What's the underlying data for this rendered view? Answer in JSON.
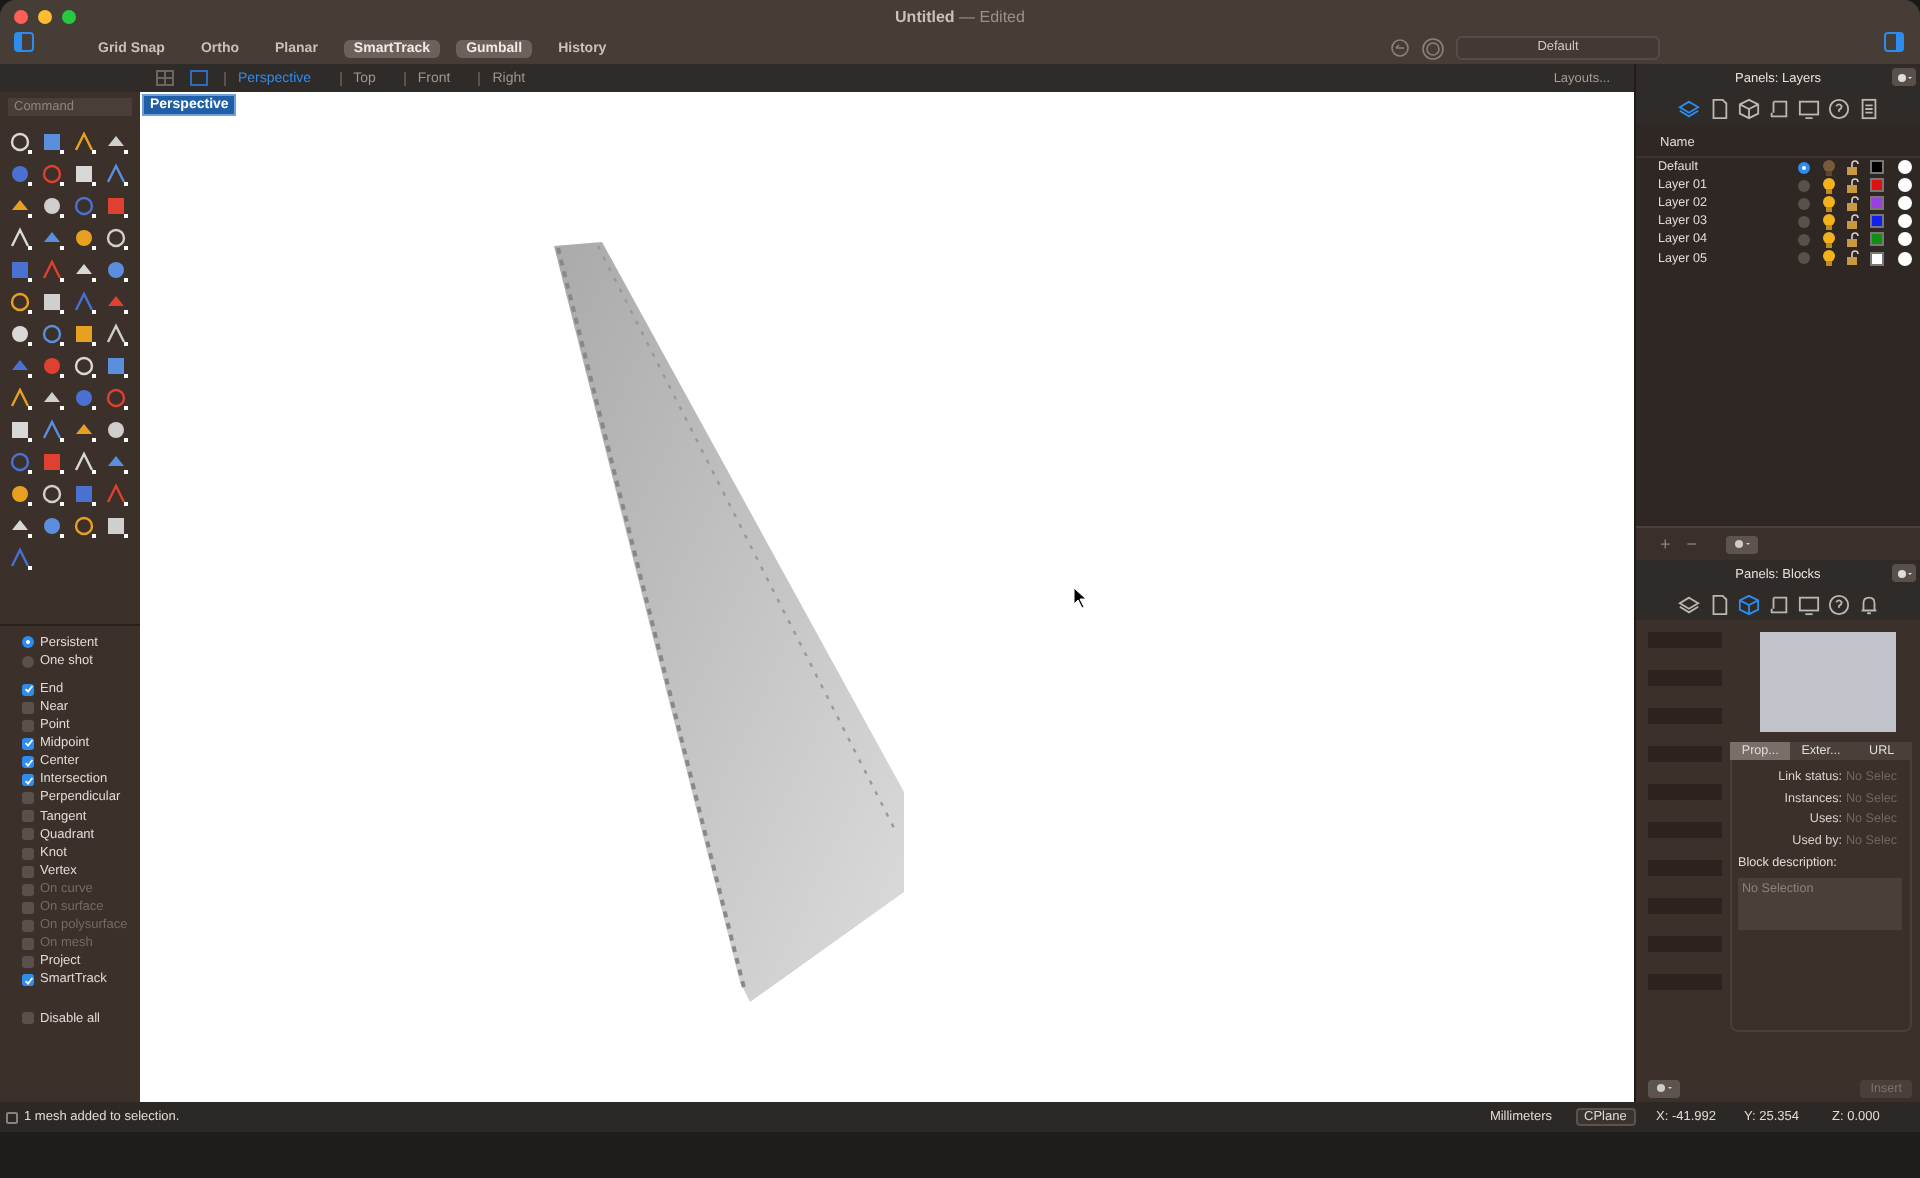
{
  "window": {
    "title": "Untitled",
    "subtitle": "— Edited"
  },
  "toolbar": {
    "toggles": [
      {
        "label": "Grid Snap",
        "on": false
      },
      {
        "label": "Ortho",
        "on": false
      },
      {
        "label": "Planar",
        "on": false
      },
      {
        "label": "SmartTrack",
        "on": true
      },
      {
        "label": "Gumball",
        "on": true
      },
      {
        "label": "History",
        "on": false
      }
    ],
    "layer_field": "Default"
  },
  "command": {
    "placeholder": "Command"
  },
  "viewport_tabs": [
    {
      "label": "Perspective",
      "selected": true
    },
    {
      "label": "Top",
      "selected": false
    },
    {
      "label": "Front",
      "selected": false
    },
    {
      "label": "Right",
      "selected": false
    }
  ],
  "layouts_button": "Layouts...",
  "viewport": {
    "label": "Perspective"
  },
  "osnap": [
    {
      "kind": "radio",
      "label": "Persistent",
      "checked": true,
      "disabled": false
    },
    {
      "kind": "radio",
      "label": "One shot",
      "checked": false,
      "disabled": false
    },
    {
      "kind": "check",
      "label": "End",
      "checked": true,
      "disabled": false
    },
    {
      "kind": "check",
      "label": "Near",
      "checked": false,
      "disabled": false
    },
    {
      "kind": "check",
      "label": "Point",
      "checked": false,
      "disabled": false
    },
    {
      "kind": "check",
      "label": "Midpoint",
      "checked": true,
      "disabled": false
    },
    {
      "kind": "check",
      "label": "Center",
      "checked": true,
      "disabled": false
    },
    {
      "kind": "check",
      "label": "Intersection",
      "checked": true,
      "disabled": false
    },
    {
      "kind": "check",
      "label": "Perpendicular",
      "checked": false,
      "disabled": false
    },
    {
      "kind": "check",
      "label": "Tangent",
      "checked": false,
      "disabled": false
    },
    {
      "kind": "check",
      "label": "Quadrant",
      "checked": false,
      "disabled": false
    },
    {
      "kind": "check",
      "label": "Knot",
      "checked": false,
      "disabled": false
    },
    {
      "kind": "check",
      "label": "Vertex",
      "checked": false,
      "disabled": false
    },
    {
      "kind": "check",
      "label": "On curve",
      "checked": false,
      "disabled": true
    },
    {
      "kind": "check",
      "label": "On surface",
      "checked": false,
      "disabled": true
    },
    {
      "kind": "check",
      "label": "On polysurface",
      "checked": false,
      "disabled": true
    },
    {
      "kind": "check",
      "label": "On mesh",
      "checked": false,
      "disabled": true
    },
    {
      "kind": "check",
      "label": "Project",
      "checked": false,
      "disabled": false
    },
    {
      "kind": "check",
      "label": "SmartTrack",
      "checked": true,
      "disabled": false
    },
    {
      "kind": "check",
      "label": "Disable all",
      "checked": false,
      "disabled": false
    }
  ],
  "layers_panel": {
    "title": "Panels: Layers",
    "column": "Name",
    "layers": [
      {
        "name": "Default",
        "current": true,
        "light_on": false,
        "color": "#000000"
      },
      {
        "name": "Layer 01",
        "current": false,
        "light_on": true,
        "color": "#e01010"
      },
      {
        "name": "Layer 02",
        "current": false,
        "light_on": true,
        "color": "#9b3fe0"
      },
      {
        "name": "Layer 03",
        "current": false,
        "light_on": true,
        "color": "#1020f0"
      },
      {
        "name": "Layer 04",
        "current": false,
        "light_on": true,
        "color": "#109010"
      },
      {
        "name": "Layer 05",
        "current": false,
        "light_on": true,
        "color": "#ffffff"
      }
    ],
    "add": "+",
    "remove": "−"
  },
  "blocks_panel": {
    "title": "Panels: Blocks",
    "tabs": [
      {
        "label": "Prop...",
        "selected": true
      },
      {
        "label": "Exter...",
        "selected": false
      },
      {
        "label": "URL",
        "selected": false
      }
    ],
    "fields": [
      {
        "label": "Link status:",
        "value": "No Selec"
      },
      {
        "label": "Instances:",
        "value": "No Selec"
      },
      {
        "label": "Uses:",
        "value": "No Selec"
      },
      {
        "label": "Used by:",
        "value": "No Selec"
      }
    ],
    "description_label": "Block description:",
    "description_placeholder": "No Selection",
    "insert": "Insert"
  },
  "status_bar": {
    "message": "1 mesh added to selection.",
    "units": "Millimeters",
    "cplane": "CPlane",
    "x": "X: -41.992",
    "y": "Y: 25.354",
    "z": "Z: 0.000"
  }
}
